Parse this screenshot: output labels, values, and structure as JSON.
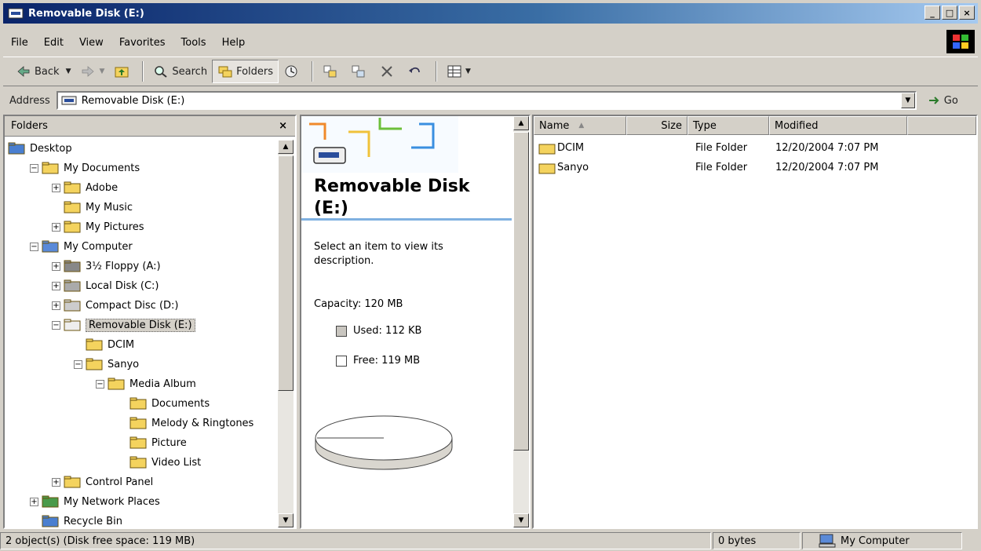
{
  "window": {
    "title": "Removable Disk (E:)",
    "buttons": [
      "_",
      "□",
      "×"
    ]
  },
  "menu": [
    "File",
    "Edit",
    "View",
    "Favorites",
    "Tools",
    "Help"
  ],
  "toolbar": {
    "back": "Back",
    "search": "Search",
    "folders": "Folders"
  },
  "address": {
    "label": "Address",
    "value": "Removable Disk (E:)",
    "go": "Go"
  },
  "folders_pane": {
    "title": "Folders",
    "close": "×",
    "tree": [
      {
        "label": "Desktop",
        "level": 0,
        "expander": "",
        "icon": "desktop-icon"
      },
      {
        "label": "My Documents",
        "level": 1,
        "expander": "−",
        "icon": "folder-open-icon"
      },
      {
        "label": "Adobe",
        "level": 2,
        "expander": "+",
        "icon": "folder-icon"
      },
      {
        "label": "My Music",
        "level": 2,
        "expander": "",
        "icon": "folder-icon"
      },
      {
        "label": "My Pictures",
        "level": 2,
        "expander": "+",
        "icon": "pictures-folder-icon"
      },
      {
        "label": "My Computer",
        "level": 1,
        "expander": "−",
        "icon": "computer-icon"
      },
      {
        "label": "3½ Floppy (A:)",
        "level": 2,
        "expander": "+",
        "icon": "floppy-icon"
      },
      {
        "label": "Local Disk (C:)",
        "level": 2,
        "expander": "+",
        "icon": "harddisk-icon"
      },
      {
        "label": "Compact Disc (D:)",
        "level": 2,
        "expander": "+",
        "icon": "cd-icon"
      },
      {
        "label": "Removable Disk (E:)",
        "level": 2,
        "expander": "−",
        "icon": "removable-disk-icon",
        "selected": true
      },
      {
        "label": "DCIM",
        "level": 3,
        "expander": "",
        "icon": "folder-icon"
      },
      {
        "label": "Sanyo",
        "level": 3,
        "expander": "−",
        "icon": "folder-icon"
      },
      {
        "label": "Media Album",
        "level": 4,
        "expander": "−",
        "icon": "folder-icon"
      },
      {
        "label": "Documents",
        "level": 5,
        "expander": "",
        "icon": "folder-icon"
      },
      {
        "label": "Melody & Ringtones",
        "level": 5,
        "expander": "",
        "icon": "folder-icon"
      },
      {
        "label": "Picture",
        "level": 5,
        "expander": "",
        "icon": "folder-icon"
      },
      {
        "label": "Video List",
        "level": 5,
        "expander": "",
        "icon": "folder-icon"
      },
      {
        "label": "Control Panel",
        "level": 2,
        "expander": "+",
        "icon": "control-panel-icon"
      },
      {
        "label": "My Network Places",
        "level": 1,
        "expander": "+",
        "icon": "network-icon"
      },
      {
        "label": "Recycle Bin",
        "level": 1,
        "expander": "",
        "icon": "recycle-bin-icon"
      }
    ]
  },
  "webview": {
    "title": "Removable Disk (E:)",
    "description": "Select an item to view its description.",
    "capacity": "Capacity: 120 MB",
    "used": "Used: 112 KB",
    "free": "Free: 119 MB",
    "used_fraction": 0.001
  },
  "list": {
    "columns": [
      "Name",
      "Size",
      "Type",
      "Modified"
    ],
    "rows": [
      {
        "name": "DCIM",
        "size": "",
        "type": "File Folder",
        "modified": "12/20/2004 7:07 PM"
      },
      {
        "name": "Sanyo",
        "size": "",
        "type": "File Folder",
        "modified": "12/20/2004 7:07 PM"
      }
    ]
  },
  "status": {
    "objects": "2 object(s) (Disk free space: 119 MB)",
    "size": "0 bytes",
    "zone": "My Computer"
  },
  "colors": {
    "title_start": "#0a246a",
    "title_end": "#a6caf0",
    "face": "#d4d0c8",
    "folder": "#f4d35e"
  }
}
